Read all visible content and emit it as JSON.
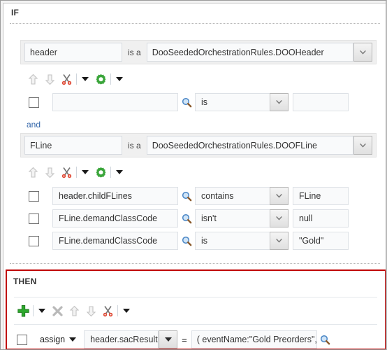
{
  "window": {
    "if_label": "IF",
    "then_label": "THEN"
  },
  "colors": {
    "then_border": "#c00000",
    "conjunction_text": "#3366aa",
    "add_icon_green": "#2ea82e",
    "gear_icon_green": "#3aa53a",
    "scissors_red": "#d94436"
  },
  "if_section": {
    "patterns": [
      {
        "name": "header-pattern",
        "alias": "header",
        "isa_label": "is a",
        "fact_type": "DooSeededOrchestrationRules.DOOHeader",
        "dropdown_icon": "chevron-down-icon",
        "toolbar": {
          "items": [
            {
              "icon": "move-up-icon",
              "label": "Move Up"
            },
            {
              "icon": "move-down-icon",
              "label": "Move Down"
            },
            {
              "icon": "cut-icon",
              "label": "Cut"
            },
            {
              "icon": "caret-down-icon",
              "label": "More"
            },
            {
              "icon": "gear-icon",
              "label": "Settings"
            },
            {
              "icon": "caret-down-icon",
              "label": "Options"
            }
          ]
        },
        "conditions": [
          {
            "checkbox_checked": false,
            "left": "",
            "left_placeholder": "",
            "search_icon": "search-icon",
            "operator": "is",
            "right": ""
          }
        ]
      },
      {
        "name": "fline-pattern",
        "conjunction": "and",
        "alias": "FLine",
        "isa_label": "is a",
        "fact_type": "DooSeededOrchestrationRules.DOOFLine",
        "dropdown_icon": "chevron-down-icon",
        "toolbar": {
          "items": [
            {
              "icon": "move-up-icon",
              "label": "Move Up"
            },
            {
              "icon": "move-down-icon",
              "label": "Move Down"
            },
            {
              "icon": "cut-icon",
              "label": "Cut"
            },
            {
              "icon": "caret-down-icon",
              "label": "More"
            },
            {
              "icon": "gear-icon",
              "label": "Settings"
            },
            {
              "icon": "caret-down-icon",
              "label": "Options"
            }
          ]
        },
        "conditions": [
          {
            "checkbox_checked": false,
            "left": "header.childFLines",
            "search_icon": "search-icon",
            "operator": "contains",
            "right": "FLine"
          },
          {
            "checkbox_checked": false,
            "left": "FLine.demandClassCode",
            "search_icon": "search-icon",
            "operator": "isn't",
            "right": "null"
          },
          {
            "checkbox_checked": false,
            "left": "FLine.demandClassCode",
            "search_icon": "search-icon",
            "operator": "is",
            "right": "\"Gold\""
          }
        ]
      }
    ]
  },
  "then_section": {
    "toolbar": {
      "items": [
        {
          "icon": "add-icon",
          "label": "Insert Action"
        },
        {
          "icon": "caret-down-icon",
          "label": "Insert Options"
        },
        {
          "icon": "delete-icon",
          "label": "Delete"
        },
        {
          "icon": "move-up-icon",
          "label": "Move Up"
        },
        {
          "icon": "move-down-icon",
          "label": "Move Down"
        },
        {
          "icon": "cut-icon",
          "label": "Cut"
        },
        {
          "icon": "caret-down-icon",
          "label": "More"
        }
      ]
    },
    "action": {
      "checkbox_checked": false,
      "action_type": "assign",
      "action_type_caret": "caret-down-icon",
      "target": "header.sacResult",
      "target_dropdown_icon": "caret-down-icon",
      "equals": "=",
      "expression": "( eventName:\"Gold Preorders\", reevaluateF",
      "search_icon": "search-icon"
    }
  }
}
